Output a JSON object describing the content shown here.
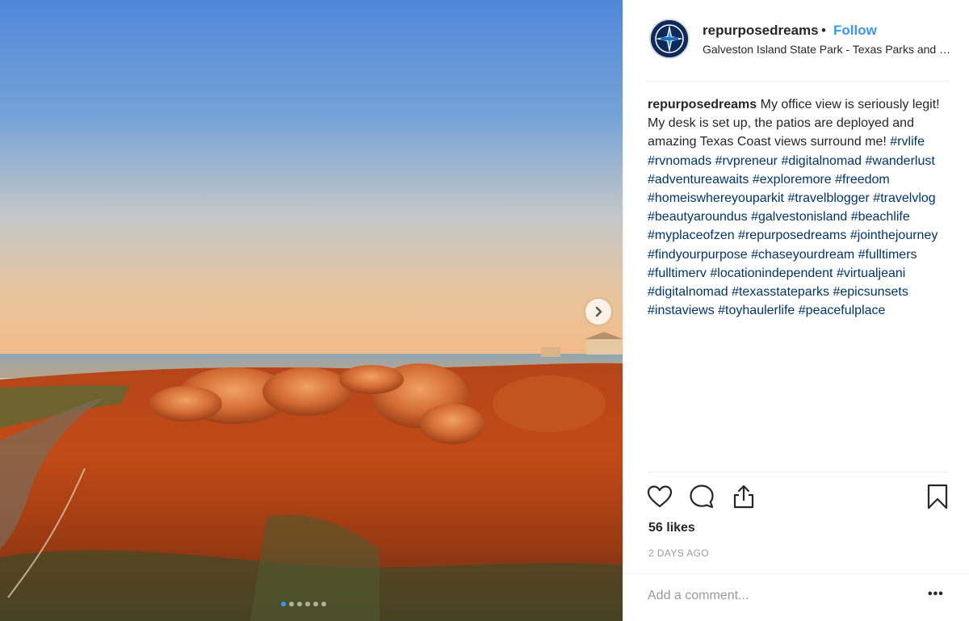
{
  "post": {
    "image_alt": "Sunset over the marsh at Galveston Island State Park",
    "carousel": {
      "total_slides": 6,
      "current_slide": 1
    }
  },
  "header": {
    "username": "repurposedreams",
    "separator": "•",
    "follow_label": "Follow",
    "location": "Galveston Island State Park - Texas Parks and Wildlife"
  },
  "caption": {
    "username": "repurposedreams",
    "text": " My office view is seriously legit! My desk is set up, the patios are deployed and amazing Texas Coast views surround me! ",
    "hashtags": [
      "#rvlife",
      "#rvnomads",
      "#rvpreneur",
      "#digitalnomad",
      "#wanderlust",
      "#adventureawaits",
      "#exploremore",
      "#freedom",
      "#homeiswhereyouparkit",
      "#travelblogger",
      "#travelvlog",
      "#beautyaroundus",
      "#galvestonisland",
      "#beachlife",
      "#myplaceofzen",
      "#repurposedreams",
      "#jointhejourney",
      "#findyourpurpose",
      "#chaseyourdream",
      "#fulltimers",
      "#fulltimerv",
      "#locationindependent",
      "#virtualjeani",
      "#digitalnomad",
      "#texasstateparks",
      "#epicsunsets",
      "#instaviews",
      "#toyhaulerlife",
      "#peacefulplace"
    ]
  },
  "actions": {
    "like_icon": "heart-icon",
    "comment_icon": "comment-bubble-icon",
    "share_icon": "share-upload-icon",
    "save_icon": "bookmark-icon",
    "likes_text": "56 likes",
    "date_text": "2 DAYS AGO"
  },
  "comment": {
    "placeholder": "Add a comment...",
    "more_label": "•••"
  },
  "colors": {
    "link_blue": "#3897f0",
    "hashtag": "#003569",
    "text": "#262626",
    "muted": "#999999"
  }
}
